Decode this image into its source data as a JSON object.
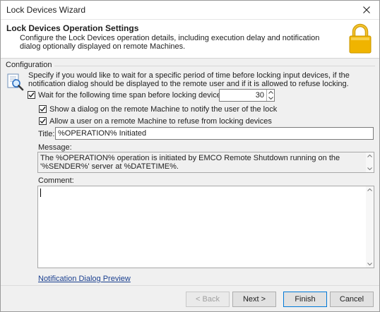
{
  "window": {
    "title": "Lock Devices Wizard"
  },
  "header": {
    "title": "Lock Devices Operation Settings",
    "description": "Configure the Lock Devices operation details, including execution delay and notification dialog optionally displayed on remote Machines.",
    "icon": "padlock-icon"
  },
  "configuration": {
    "group_label": "Configuration",
    "description": "Specify if you would like to wait for a specific period of time before locking input devices, if the notification dialog should be displayed to the remote user and if it is allowed to refuse locking.",
    "wait": {
      "label": "Wait for the following time span before locking devices (sec):",
      "checked": true,
      "value": "30"
    },
    "show_dialog": {
      "label": "Show a dialog on the remote Machine to notify the user of the lock",
      "checked": true
    },
    "allow_refuse": {
      "label": "Allow a user on a remote Machine to refuse from locking devices",
      "checked": true
    },
    "title_label": "Title:",
    "title_value": "%OPERATION% Initiated",
    "message_label": "Message:",
    "message_value": "The %OPERATION% operation is initiated by EMCO Remote Shutdown running on the '%SENDER%' server at %DATETIME%.",
    "comment_label": "Comment:",
    "comment_value": "",
    "preview_link": "Notification Dialog Preview"
  },
  "footer": {
    "back": "< Back",
    "next": "Next >",
    "finish": "Finish",
    "cancel": "Cancel"
  },
  "colors": {
    "accent": "#0078d7",
    "link": "#1a3f8f",
    "lock_gold": "#f0b400"
  }
}
